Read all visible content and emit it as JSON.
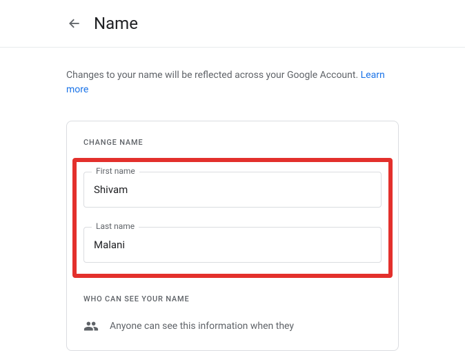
{
  "header": {
    "title": "Name"
  },
  "description": {
    "text": "Changes to your name will be reflected across your Google Account. ",
    "learn_more": "Learn more"
  },
  "form": {
    "section_heading": "CHANGE NAME",
    "first_name_label": "First name",
    "first_name_value": "Shivam",
    "last_name_label": "Last name",
    "last_name_value": "Malani"
  },
  "visibility": {
    "heading": "WHO CAN SEE YOUR NAME",
    "text": "Anyone can see this information when they"
  }
}
